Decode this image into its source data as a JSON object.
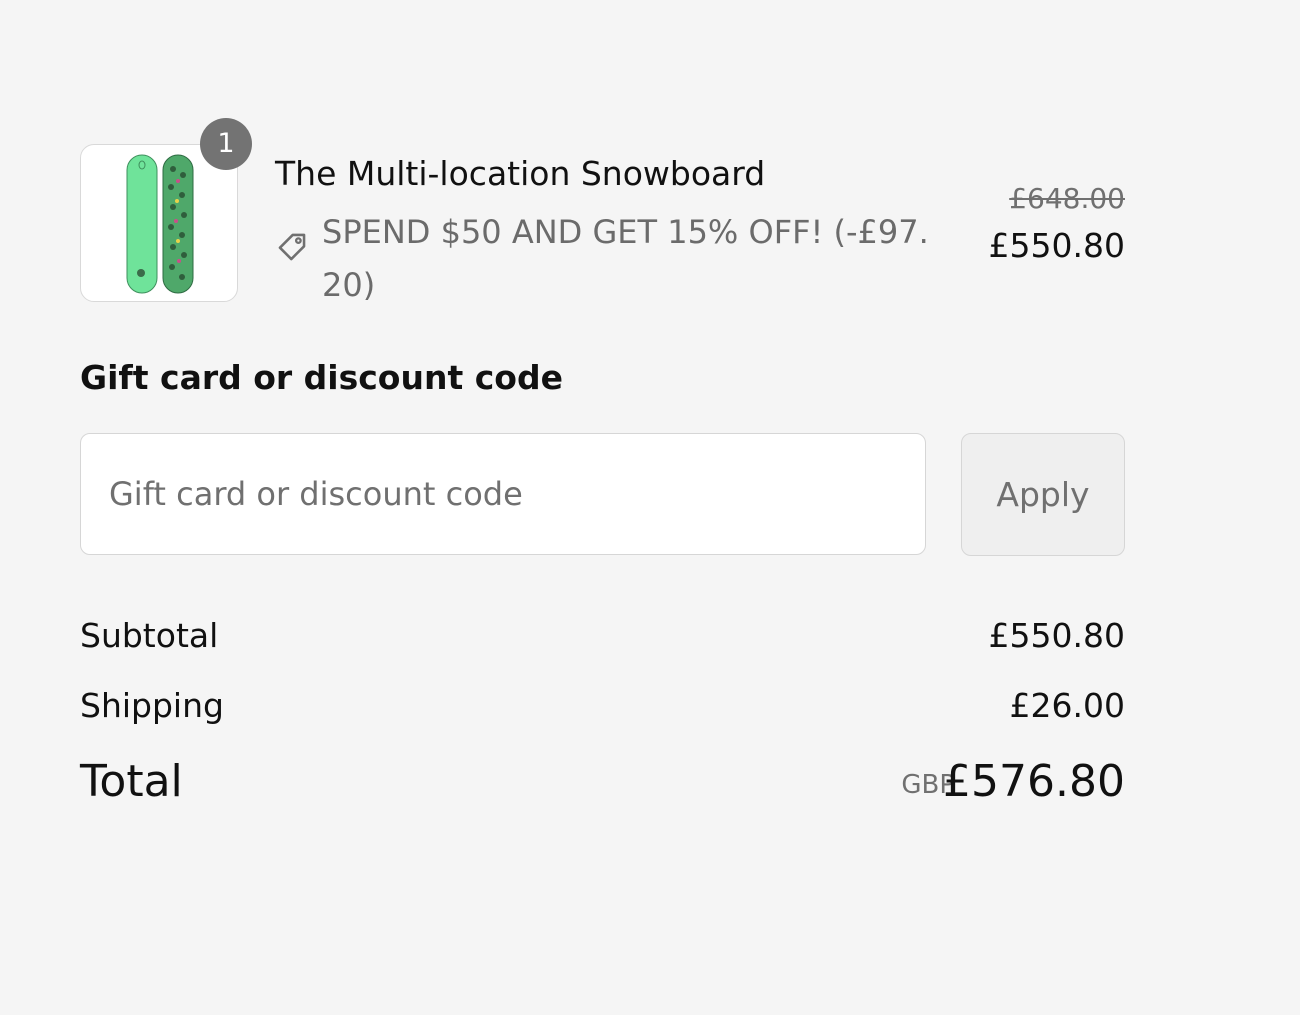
{
  "line_item": {
    "quantity": "1",
    "title": "The Multi-location Snowboard",
    "discount_text": "SPEND $50 AND GET 15% OFF! (-£97.20)",
    "compare_at_price": "£648.00",
    "price": "£550.80",
    "image_icon": "snowboard-image",
    "tag_icon": "tag-icon"
  },
  "discount_code": {
    "heading": "Gift card or discount code",
    "placeholder": "Gift card or discount code",
    "value": "",
    "apply_label": "Apply"
  },
  "totals": {
    "subtotal_label": "Subtotal",
    "subtotal_value": "£550.80",
    "shipping_label": "Shipping",
    "shipping_value": "£26.00",
    "total_label": "Total",
    "currency": "GBP",
    "total_value": "£576.80"
  },
  "colors": {
    "background": "#f5f5f5",
    "badge": "#737373",
    "muted_text": "#707070",
    "board_light": "#6fe39a",
    "board_dark": "#4fa86a"
  }
}
